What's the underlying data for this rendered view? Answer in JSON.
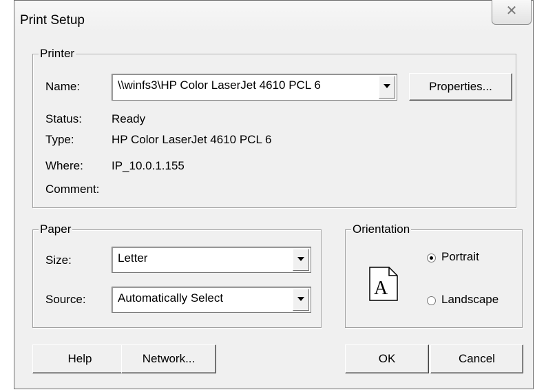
{
  "dialog": {
    "title": "Print Setup",
    "close_glyph": "✕"
  },
  "printer": {
    "group_label": "Printer",
    "name_label": "Name:",
    "name_value": "\\\\winfs3\\HP Color LaserJet 4610 PCL 6",
    "properties_button": "Properties...",
    "status_label": "Status:",
    "status_value": "Ready",
    "type_label": "Type:",
    "type_value": "HP Color LaserJet 4610 PCL 6",
    "where_label": "Where:",
    "where_value": "IP_10.0.1.155",
    "comment_label": "Comment:",
    "comment_value": ""
  },
  "paper": {
    "group_label": "Paper",
    "size_label": "Size:",
    "size_value": "Letter",
    "source_label": "Source:",
    "source_value": "Automatically Select"
  },
  "orientation": {
    "group_label": "Orientation",
    "icon_letter": "A",
    "portrait_label": "Portrait",
    "landscape_label": "Landscape",
    "selected": "Portrait"
  },
  "buttons": {
    "help": "Help",
    "network": "Network...",
    "ok": "OK",
    "cancel": "Cancel"
  },
  "icons": {
    "close": "close-icon",
    "dropdown": "chevron-down-icon",
    "page": "portrait-page-icon"
  }
}
